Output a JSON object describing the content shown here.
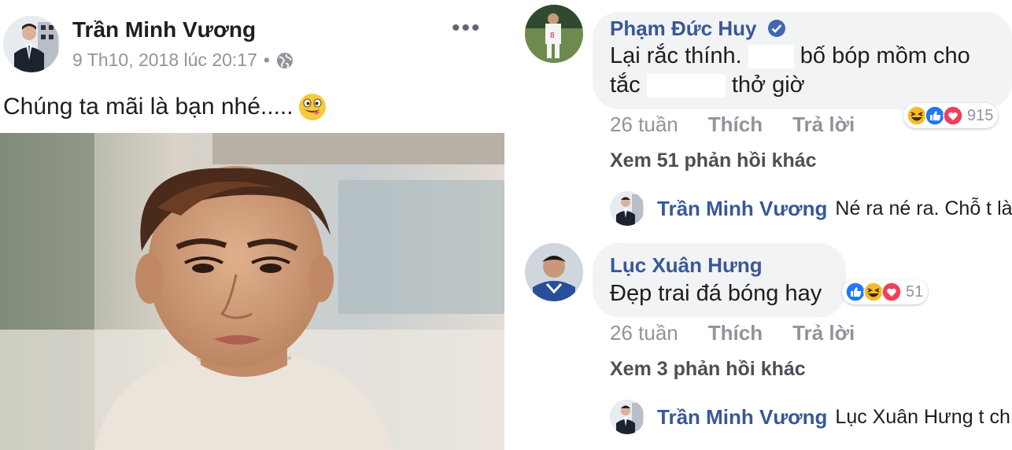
{
  "post": {
    "author": "Trần Minh Vương",
    "timestamp": "9 Th10, 2018 lúc 20:17",
    "separator": "•",
    "privacy_icon": "globe-icon",
    "more_label": "•••",
    "text": "Chúng ta mãi là bạn nhé.....",
    "emoji": "grinning-tongue-emoji"
  },
  "comments": [
    {
      "author": "Phạm Đức Huy",
      "verified": true,
      "text_part1": "Lại rắc thính.",
      "text_part2": "bố bóp mồm cho",
      "text_part3": "tắc",
      "text_part4": "thở giờ",
      "time": "26 tuần",
      "like_label": "Thích",
      "reply_label": "Trả lời",
      "reactions": [
        "haha-icon",
        "like-icon",
        "love-icon"
      ],
      "reaction_count": "915",
      "more_replies": "Xem 51 phản hồi khác",
      "reply": {
        "author": "Trần Minh Vương",
        "text": "Né ra né ra. Chỗ t là..."
      }
    },
    {
      "author": "Lục Xuân Hưng",
      "verified": false,
      "text": "Đẹp trai đá bóng hay",
      "time": "26 tuần",
      "like_label": "Thích",
      "reply_label": "Trả lời",
      "reactions": [
        "like-icon",
        "haha-icon",
        "love-icon"
      ],
      "reaction_count": "51",
      "more_replies": "Xem 3 phản hồi khác",
      "reply": {
        "author": "Trần Minh Vương",
        "text": "Lục Xuân Hưng t ch..."
      }
    }
  ],
  "colors": {
    "name_link": "#385898",
    "muted": "#90949c",
    "bubble": "#f2f3f5",
    "like_blue": "#2078f4",
    "love_red": "#f33e58",
    "haha_yellow": "#f7b928"
  }
}
